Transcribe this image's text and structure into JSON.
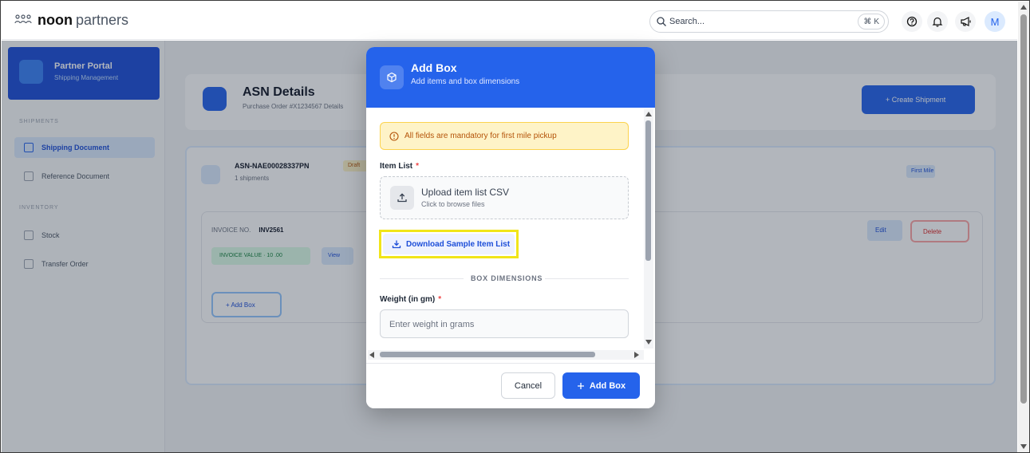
{
  "app": {
    "logo_noon": "noon",
    "logo_partners": "partners",
    "search_placeholder": "Search...",
    "shortcut_symbol": "⌘",
    "shortcut_key": "K",
    "avatar_initial": "M",
    "icons": [
      "help-icon",
      "bell-icon",
      "megaphone-icon"
    ]
  },
  "background": {
    "brand_title": "Partner Portal",
    "brand_sub": "Shipping Management",
    "section1": "SHIPMENTS",
    "nav1": "Shipping Document",
    "nav2": "Reference Document",
    "section2": "INVENTORY",
    "nav3": "Stock",
    "nav4": "Transfer Order",
    "page_title": "ASN Details",
    "page_sub": "Purchase Order #X1234567 Details",
    "primary_action": "+ Create Shipment",
    "asn_id": "ASN-NAE00028337PN",
    "asn_sub": "1 shipments",
    "asn_tag": "Draft",
    "asn_btn": "First Mile",
    "invoice_label": "INVOICE NO.",
    "invoice_value": "INV2561",
    "status_pill": "INVOICE VALUE · 10 .00",
    "view_pill": "View",
    "add_box": "+ Add Box",
    "edit": "Edit",
    "delete": "Delete"
  },
  "modal": {
    "title": "Add Box",
    "subtitle": "Add items and box dimensions",
    "alert": "All fields are mandatory for first mile pickup",
    "item_list_label": "Item List",
    "required_mark": "*",
    "upload_title": "Upload item list CSV",
    "upload_sub": "Click to browse files",
    "download_label": "Download Sample Item List",
    "section_label": "BOX DIMENSIONS",
    "weight_label": "Weight (in gm)",
    "weight_placeholder": "Enter weight in grams",
    "cancel_label": "Cancel",
    "add_label": "Add Box"
  },
  "colors": {
    "primary": "#2563eb",
    "alert_bg": "#fef3c7",
    "highlight": "#f1e51a"
  }
}
